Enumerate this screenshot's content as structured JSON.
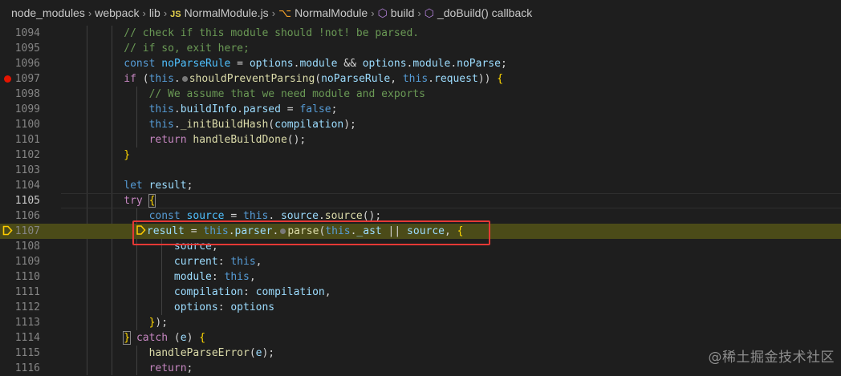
{
  "breadcrumb": {
    "items": [
      "node_modules",
      "webpack",
      "lib",
      "NormalModule.js",
      "NormalModule",
      "build",
      "_doBuild() callback"
    ],
    "icons": [
      "js-file-icon",
      "class-icon",
      "method-icon",
      "method-icon"
    ]
  },
  "gutter": {
    "breakpoint_line": "1097",
    "execution_line": "1107"
  },
  "code_lines": [
    {
      "num": "1094",
      "text": "// check if this module should !not! be parsed."
    },
    {
      "num": "1095",
      "text": "// if so, exit here;"
    },
    {
      "num": "1096",
      "text": "const noParseRule = options.module && options.module.noParse;"
    },
    {
      "num": "1097",
      "text": "if (this.shouldPreventParsing(noParseRule, this.request)) {"
    },
    {
      "num": "1098",
      "text": "// We assume that we need module and exports"
    },
    {
      "num": "1099",
      "text": "this.buildInfo.parsed = false;"
    },
    {
      "num": "1100",
      "text": "this._initBuildHash(compilation);"
    },
    {
      "num": "1101",
      "text": "return handleBuildDone();"
    },
    {
      "num": "1102",
      "text": "}"
    },
    {
      "num": "1103",
      "text": ""
    },
    {
      "num": "1104",
      "text": "let result;"
    },
    {
      "num": "1105",
      "text": "try {"
    },
    {
      "num": "1106",
      "text": "const source = this. source.source();"
    },
    {
      "num": "1107",
      "text": "result = this.parser.parse(this._ast || source, {"
    },
    {
      "num": "1108",
      "text": "source,"
    },
    {
      "num": "1109",
      "text": "current: this,"
    },
    {
      "num": "1110",
      "text": "module: this,"
    },
    {
      "num": "1111",
      "text": "compilation: compilation,"
    },
    {
      "num": "1112",
      "text": "options: options"
    },
    {
      "num": "1113",
      "text": "});"
    },
    {
      "num": "1114",
      "text": "} catch (e) {"
    },
    {
      "num": "1115",
      "text": "handleParseError(e);"
    },
    {
      "num": "1116",
      "text": "return;"
    }
  ],
  "watermark": "@稀土掘金技术社区",
  "colors": {
    "background": "#1e1e1e",
    "execution_line_bg": "#4b4b18",
    "breakpoint": "#e51400",
    "highlight_box": "#e53935"
  }
}
